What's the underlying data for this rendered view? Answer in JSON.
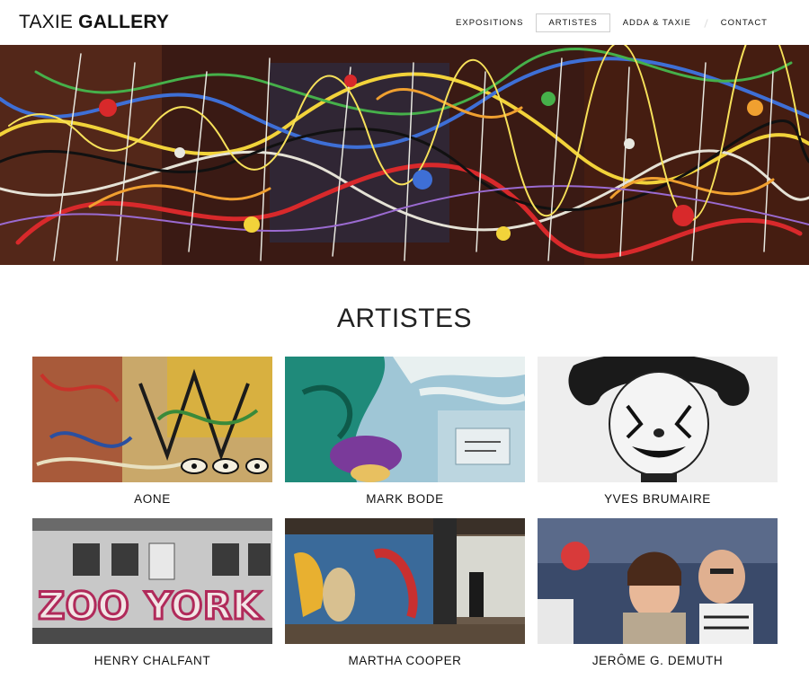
{
  "header": {
    "logo_part1": "TAXIE",
    "logo_part2": "GALLERY",
    "nav": [
      {
        "label": "EXPOSITIONS",
        "active": false
      },
      {
        "label": "ARTISTES",
        "active": true
      },
      {
        "label": "ADDA & TAXIE",
        "active": false
      },
      {
        "label": "CONTACT",
        "active": false
      }
    ]
  },
  "hero": {
    "image": "abstract-drip-painting"
  },
  "main": {
    "title": "ARTISTES",
    "artists": [
      {
        "name": "AONE",
        "image": "graffiti-painting"
      },
      {
        "name": "MARK BODE",
        "image": "comic-mural"
      },
      {
        "name": "YVES BRUMAIRE",
        "image": "clown-portrait-bw"
      },
      {
        "name": "HENRY CHALFANT",
        "image": "graffiti-subway-car"
      },
      {
        "name": "MARTHA COOPER",
        "image": "subway-station-photo"
      },
      {
        "name": "JERÔME G. DEMUTH",
        "image": "couple-photo"
      }
    ]
  },
  "colors": {
    "accent": "#111111",
    "nav_border": "#cfcfcf",
    "background": "#ffffff"
  }
}
